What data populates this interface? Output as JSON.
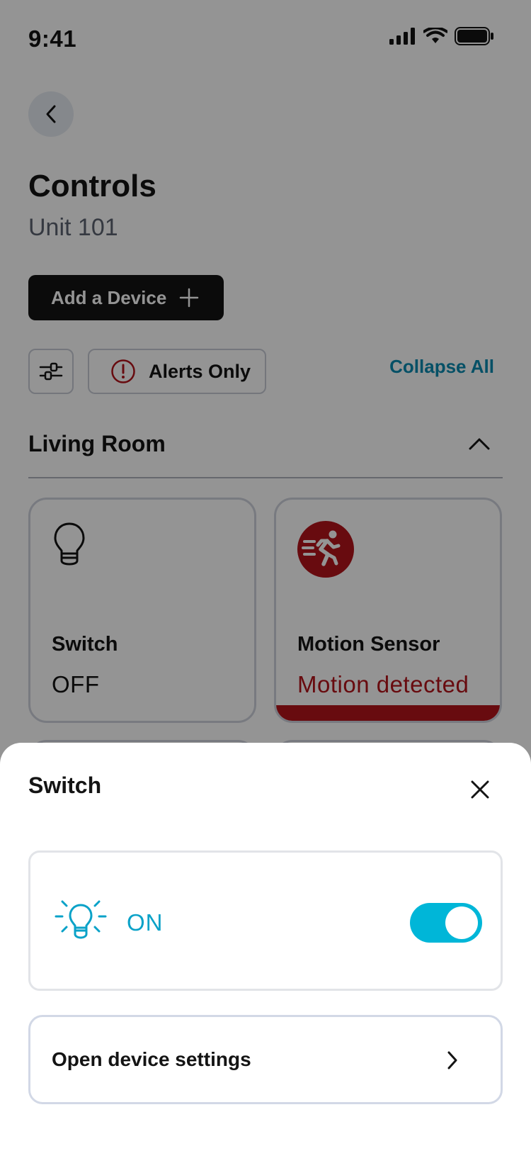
{
  "status_bar": {
    "time": "9:41"
  },
  "header": {
    "title": "Controls",
    "subtitle": "Unit 101"
  },
  "actions": {
    "add_device_label": "Add a Device",
    "alerts_only_label": "Alerts Only",
    "collapse_all_label": "Collapse All"
  },
  "section": {
    "title": "Living Room"
  },
  "devices": [
    {
      "name": "Switch",
      "status": "OFF",
      "icon": "lightbulb-icon"
    },
    {
      "name": "Motion Sensor",
      "status": "Motion detected",
      "icon": "running-person-icon"
    }
  ],
  "sheet": {
    "title": "Switch",
    "power_state_label": "ON",
    "toggle_on": true,
    "settings_label": "Open device settings"
  },
  "colors": {
    "accent": "#00b6d8",
    "alert": "#b3141b",
    "link": "#0a8bb0",
    "primary_button": "#141414"
  }
}
